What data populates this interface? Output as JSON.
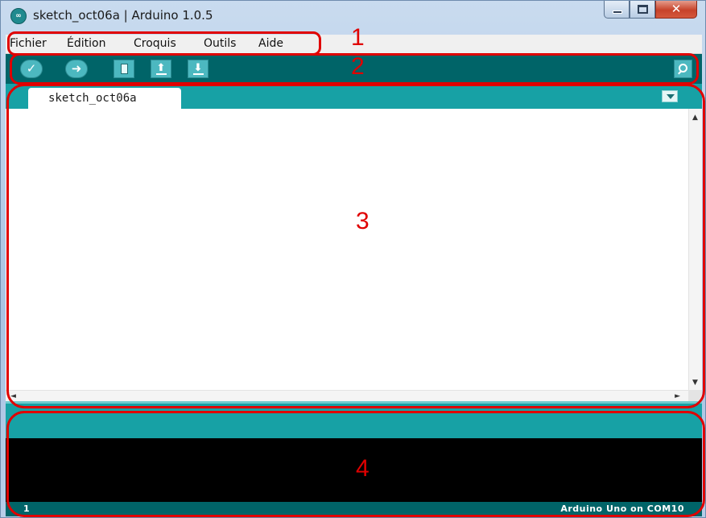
{
  "window": {
    "title": "sketch_oct06a | Arduino 1.0.5",
    "icon": "arduino-logo-icon",
    "icon_text": "∞",
    "controls": [
      "minimize-icon",
      "maximize-icon",
      "close-icon"
    ],
    "close_glyph": "✕"
  },
  "menubar": {
    "items": [
      {
        "label": "Fichier"
      },
      {
        "label": "Édition"
      },
      {
        "label": "Croquis"
      },
      {
        "label": "Outils"
      },
      {
        "label": "Aide"
      }
    ]
  },
  "toolbar": {
    "buttons": [
      {
        "name": "verify-button",
        "icon": "checkmark-icon",
        "glyph": "✓"
      },
      {
        "name": "upload-button",
        "icon": "arrow-right-icon",
        "glyph": "➜"
      },
      {
        "name": "new-button",
        "icon": "new-document-icon"
      },
      {
        "name": "open-button",
        "icon": "arrow-up-icon",
        "glyph": "⬆"
      },
      {
        "name": "save-button",
        "icon": "arrow-down-icon",
        "glyph": "⬇"
      }
    ],
    "serial_monitor_icon": "magnifier-icon"
  },
  "tabs": {
    "items": [
      {
        "label": "sketch_oct06a",
        "active": true
      }
    ],
    "menu_icon": "chevron-down-icon"
  },
  "editor": {
    "content": "",
    "scroll_up_glyph": "▲",
    "scroll_down_glyph": "▼",
    "scroll_left_glyph": "◄",
    "scroll_right_glyph": "►"
  },
  "console": {
    "content": ""
  },
  "statusbar": {
    "line": "1",
    "board": "Arduino Uno on COM10"
  },
  "annotations": [
    {
      "number": "1"
    },
    {
      "number": "2"
    },
    {
      "number": "3"
    },
    {
      "number": "4"
    }
  ],
  "colors": {
    "toolbar": "#006468",
    "tabstrip": "#17a1a5",
    "button": "#4cb8c0",
    "annotation": "#e00000"
  }
}
